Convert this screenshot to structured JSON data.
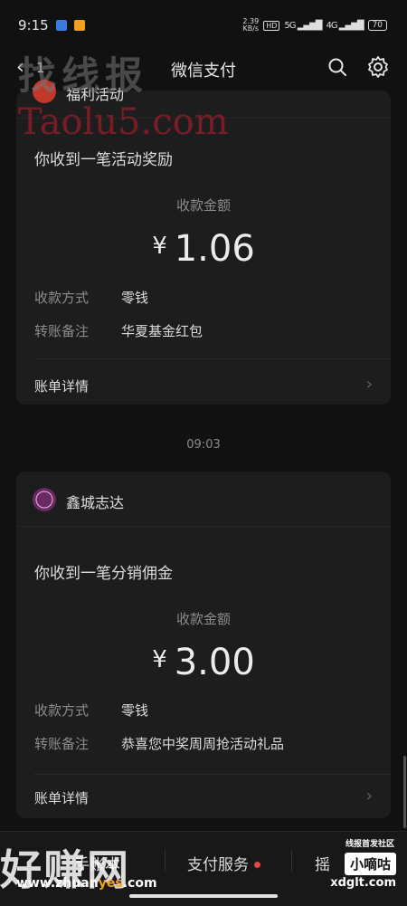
{
  "status_bar": {
    "time": "9:15",
    "net_speed_value": "2.39",
    "net_speed_unit": "KB/s",
    "hd": "HD",
    "net_5g": "5G",
    "net_4g": "4G",
    "battery": "70",
    "app_icon_colors": [
      "#3b7be0",
      "#f0a020"
    ]
  },
  "nav": {
    "back_count": "1",
    "title": "微信支付"
  },
  "watermarks": {
    "top_cn": "找线报",
    "top_en": "Taolu5.com",
    "bottom_left_big": "好赚网",
    "bottom_left_url_a": "www.zhuan",
    "bottom_left_url_b": "yes",
    "bottom_left_url_c": ".com",
    "bottom_right_small": "线报首发社区",
    "bottom_right_box": "小嘀咕",
    "bottom_right_url": "xdglt.com"
  },
  "cards": [
    {
      "merchant": "福利活动",
      "message": "你收到一笔活动奖励",
      "amount_label": "收款金额",
      "currency": "¥",
      "amount": "1.06",
      "rows": [
        {
          "label": "收款方式",
          "value": "零钱"
        },
        {
          "label": "转账备注",
          "value": "华夏基金红包"
        }
      ],
      "detail": "账单详情"
    },
    {
      "merchant": "鑫城志达",
      "message": "你收到一笔分销佣金",
      "amount_label": "收款金额",
      "currency": "¥",
      "amount": "3.00",
      "rows": [
        {
          "label": "收款方式",
          "value": "零钱"
        },
        {
          "label": "转账备注",
          "value": "恭喜您中奖周周抢活动礼品"
        }
      ],
      "detail": "账单详情"
    }
  ],
  "time_separator": "09:03",
  "bottom_bar": {
    "left": "手账本",
    "center": "支付服务",
    "right": "摇"
  },
  "colors": {
    "background": "#111111",
    "card": "#1d1d1d",
    "red_dot": "#e04848",
    "avatar": "#6b2a64"
  }
}
